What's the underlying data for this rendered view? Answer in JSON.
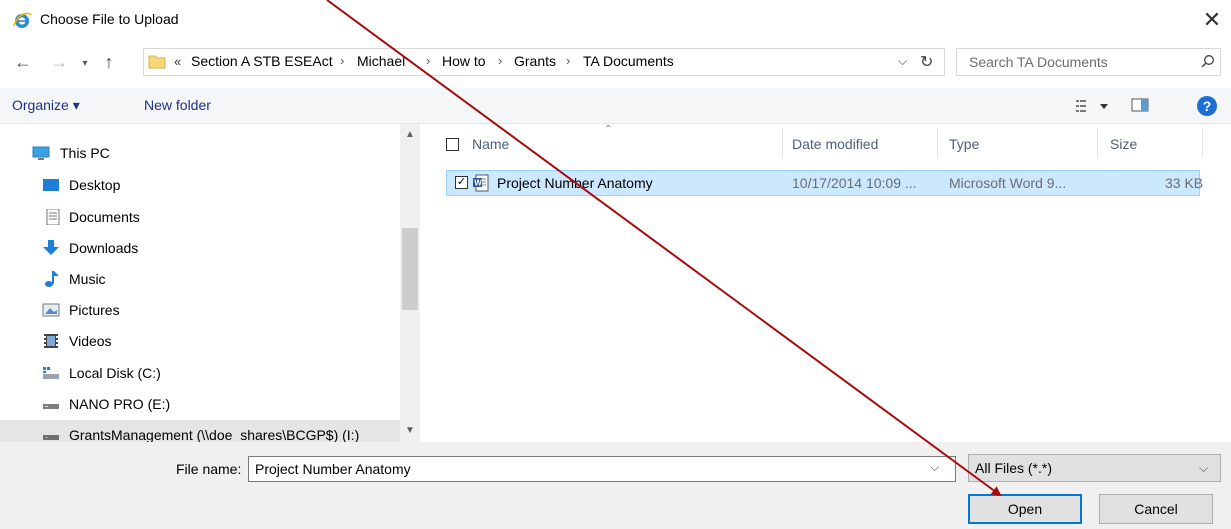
{
  "window": {
    "title": "Choose File to Upload",
    "close_glyph": "✕",
    "app_icon": "internet-explorer-icon"
  },
  "address": {
    "overflow": "«",
    "breadcrumbs": [
      "Section A STB ESEAct",
      "Michael",
      "How to",
      "Grants",
      "TA Documents"
    ],
    "separator": "›",
    "dropdown_glyph": "⌵",
    "refresh_glyph": "↻"
  },
  "search": {
    "placeholder": "Search TA Documents"
  },
  "toolbar": {
    "organize": "Organize ▾",
    "new_folder": "New folder",
    "help": "?"
  },
  "nav_pane": {
    "items": [
      {
        "label": "This PC",
        "icon": "this-pc-icon"
      },
      {
        "label": "Desktop",
        "icon": "desktop-icon"
      },
      {
        "label": "Documents",
        "icon": "documents-icon"
      },
      {
        "label": "Downloads",
        "icon": "downloads-icon"
      },
      {
        "label": "Music",
        "icon": "music-icon"
      },
      {
        "label": "Pictures",
        "icon": "pictures-icon"
      },
      {
        "label": "Videos",
        "icon": "videos-icon"
      },
      {
        "label": "Local Disk (C:)",
        "icon": "local-disk-icon"
      },
      {
        "label": "NANO PRO (E:)",
        "icon": "usb-drive-icon"
      },
      {
        "label": "GrantsManagement (\\\\doe_shares\\BCGP$) (I:)",
        "icon": "network-drive-icon"
      }
    ]
  },
  "file_list": {
    "columns": [
      "Name",
      "Date modified",
      "Type",
      "Size"
    ],
    "rows": [
      {
        "name": "Project Number Anatomy",
        "date": "10/17/2014 10:09 ...",
        "type": "Microsoft Word 9...",
        "size": "33 KB",
        "selected": true
      }
    ]
  },
  "bottom": {
    "file_name_label": "File name:",
    "file_name_value": "Project Number Anatomy",
    "file_type_value": "All Files (*.*)",
    "open_label": "Open",
    "cancel_label": "Cancel"
  },
  "colors": {
    "selection_bg": "#cce8ff",
    "accent": "#0078d7",
    "annotation_arrow": "#a50d0d"
  }
}
